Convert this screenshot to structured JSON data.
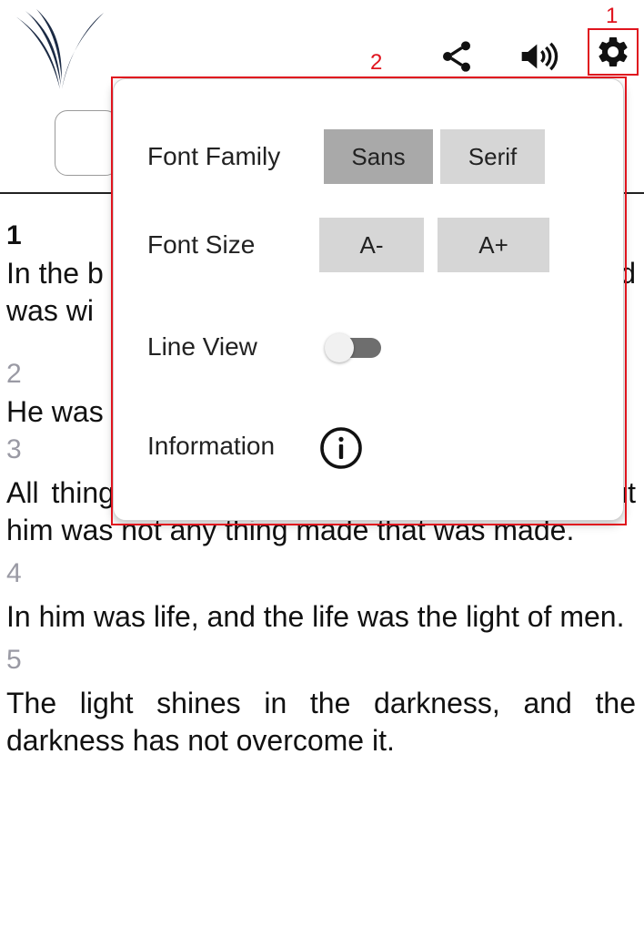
{
  "annotations": {
    "gear_marker": "1",
    "popup_marker": "2"
  },
  "settings": {
    "font_family_label": "Font Family",
    "font_family_options": [
      "Sans",
      "Serif"
    ],
    "font_family_selected": "Sans",
    "font_size_label": "Font Size",
    "font_size_decrease": "A-",
    "font_size_increase": "A+",
    "line_view_label": "Line View",
    "line_view_on": false,
    "information_label": "Information"
  },
  "verses": [
    {
      "num": "1",
      "text": "In the b"
    },
    {
      "text2": "was wi"
    },
    {
      "num": "2",
      "text": "He was"
    },
    {
      "num": "3",
      "text": "All things were made through him, and without him was not any thing made that was made."
    },
    {
      "num": "4",
      "text": "In him was life, and the life was the light of men."
    },
    {
      "num": "5",
      "text": "The light shines in the darkness, and the darkness has not overcome it."
    }
  ],
  "verse1_right_fragment": "d",
  "colors": {
    "annotation": "#e0141e",
    "logo": "#1b2a44",
    "verse_number": "#9a9aa4"
  },
  "icons": [
    "app-logo",
    "share-icon",
    "volume-icon",
    "gear-icon",
    "info-icon"
  ]
}
